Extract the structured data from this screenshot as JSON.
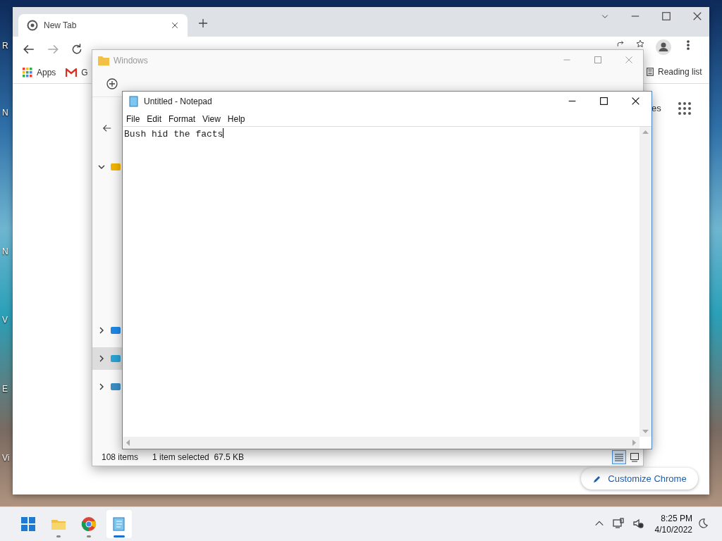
{
  "desktop": {
    "icon_labels": [
      "R",
      "N",
      "N",
      "V",
      "E",
      "Vi"
    ]
  },
  "chrome": {
    "tab": {
      "title": "New Tab"
    },
    "bookmarks": [
      {
        "kind": "apps",
        "label": "Apps"
      },
      {
        "kind": "gmail",
        "label": "G"
      }
    ],
    "reading_list": "Reading list",
    "partial_link": "es",
    "customize_button": "Customize Chrome"
  },
  "explorer": {
    "title": "Windows",
    "nav_tree": [
      {
        "expanded": true,
        "selected": false
      },
      {
        "expanded": false,
        "selected": false
      },
      {
        "expanded": false,
        "selected": true
      },
      {
        "expanded": false,
        "selected": false
      }
    ],
    "status": {
      "count": "108 items",
      "selection": "1 item selected",
      "size": "67.5 KB"
    },
    "view_buttons": [
      {
        "kind": "details",
        "selected": true
      },
      {
        "kind": "tiles",
        "selected": false
      }
    ]
  },
  "notepad": {
    "title": "Untitled - Notepad",
    "menu": [
      "File",
      "Edit",
      "Format",
      "View",
      "Help"
    ],
    "text": "Bush hid the facts"
  },
  "taskbar": {
    "apps": [
      {
        "kind": "start",
        "running": false,
        "selected": false
      },
      {
        "kind": "explorer",
        "running": true,
        "selected": false
      },
      {
        "kind": "chrome",
        "running": true,
        "selected": false
      },
      {
        "kind": "notepad",
        "running": true,
        "selected": true
      }
    ],
    "clock": {
      "time": "8:25 PM",
      "date": "4/10/2022"
    }
  }
}
